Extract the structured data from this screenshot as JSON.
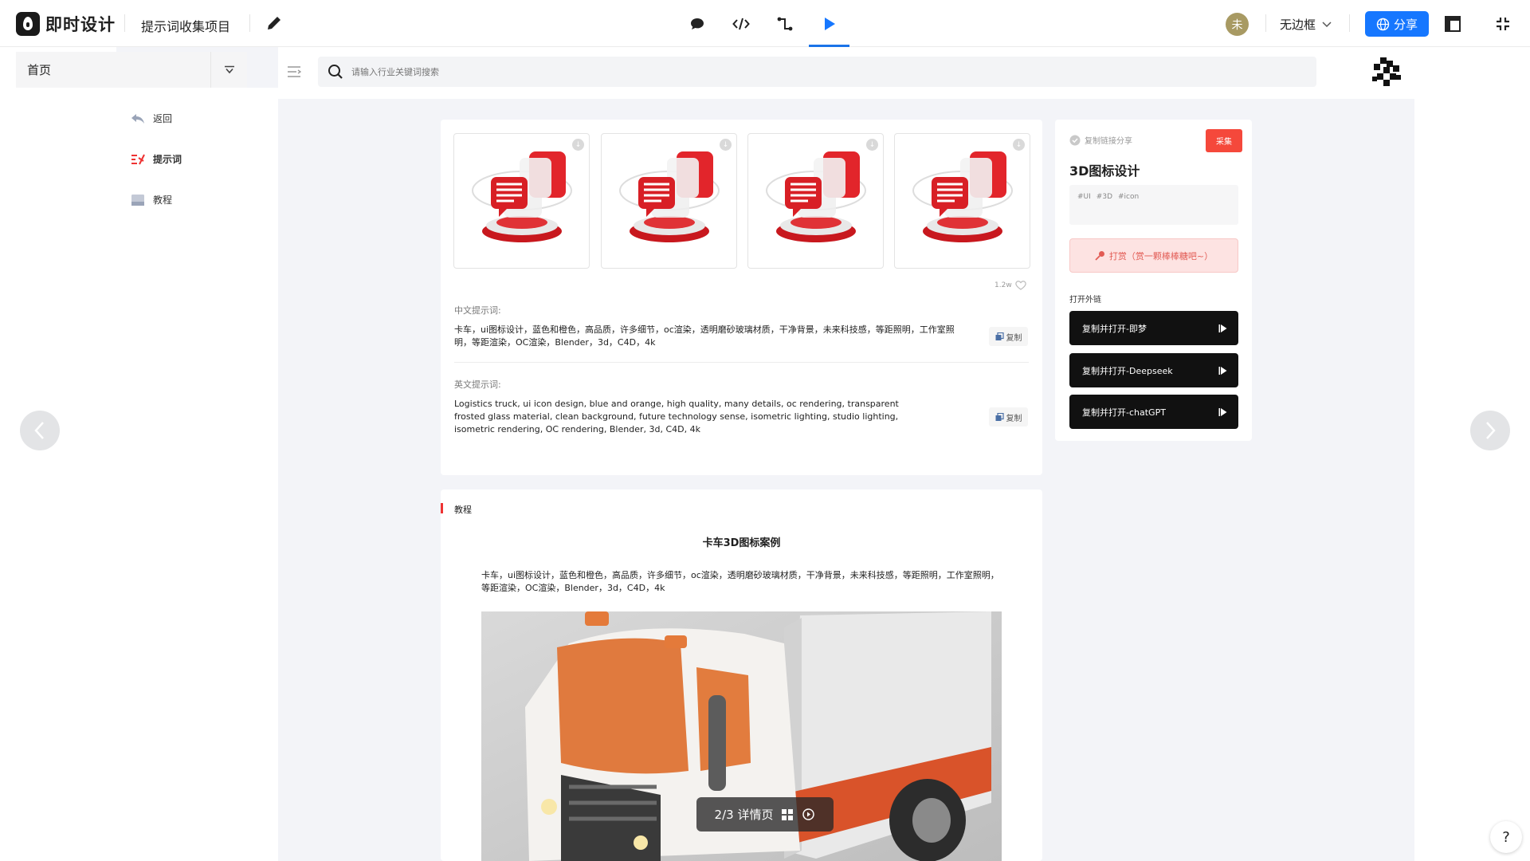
{
  "app": {
    "name": "即时设计",
    "project_title": "提示词收集项目"
  },
  "header": {
    "avatar_text": "未",
    "frame_option": "无边框",
    "share_label": "分享",
    "modes": [
      "comment",
      "code",
      "prototype",
      "preview"
    ],
    "active_mode": "preview",
    "accent": "#1677ff"
  },
  "left_panel": {
    "page_name": "首页"
  },
  "site": {
    "search_placeholder": "请输入行业关键词搜索",
    "nav": [
      {
        "label": "返回",
        "icon": "reply-arrow-icon"
      },
      {
        "label": "提示词",
        "icon": "prompt-icon"
      },
      {
        "label": "教程",
        "icon": "book-icon"
      }
    ],
    "detail": {
      "likes": "1.2w",
      "cn_label": "中文提示词:",
      "cn_text": "卡车，ui图标设计，蓝色和橙色，高品质，许多细节，oc渲染，透明磨砂玻璃材质，干净背景，未来科技感，等距照明，工作室照明，等距渲染，OC渲染，Blender，3d，C4D，4k",
      "en_label": "英文提示词:",
      "en_text": "Logistics truck, ui icon design, blue and orange, high quality, many details, oc rendering, transparent frosted glass material, clean background, future technology sense, isometric lighting, studio lighting, isometric rendering, OC rendering, Blender, 3d, C4D, 4k",
      "copy_label": "复制"
    },
    "info": {
      "share_link": "复制链接分享",
      "collect": "采集",
      "title": "3D图标设计",
      "tags": [
        "#UI",
        "#3D",
        "#icon"
      ],
      "reward": "打赏（赏一颗棒棒糖吧~）",
      "ext_label": "打开外链",
      "ext_buttons": [
        "复制并打开-即梦",
        "复制并打开-Deepseek",
        "复制并打开-chatGPT"
      ]
    },
    "tutorial": {
      "label": "教程",
      "title": "卡车3D图标案例",
      "body": "卡车，ui图标设计，蓝色和橙色，高品质，许多细节，oc渲染，透明磨砂玻璃材质，干净背景，未来科技感，等距照明，工作室照明，等距渲染，OC渲染，Blender，3d，C4D，4k"
    }
  },
  "preview": {
    "page_indicator": "2/3 详情页",
    "help": "?"
  }
}
